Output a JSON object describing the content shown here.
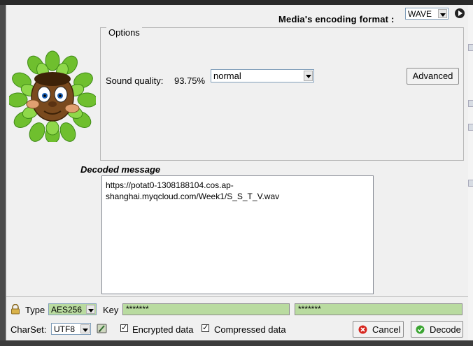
{
  "header": {
    "encoding_label": "Media's encoding format :",
    "encoding_value": "WAVE"
  },
  "options": {
    "title": "Options",
    "sound_quality_label": "Sound quality:",
    "sound_quality_value": "93.75%",
    "quality_select": "normal",
    "advanced_button": "Advanced"
  },
  "decoded": {
    "title": "Decoded message",
    "line1": "https://potat0-1308188104.cos.ap-",
    "line2": "shanghai.myqcloud.com/Week1/S_S_T_V.wav"
  },
  "footer": {
    "type_label": "Type",
    "type_value": "AES256",
    "key_label": "Key",
    "key_value": "*******",
    "key_confirm": "*******",
    "charset_label": "CharSet:",
    "charset_value": "UTF8",
    "encrypted_label": "Encrypted data",
    "compressed_label": "Compressed data",
    "cancel_button": "Cancel",
    "decode_button": "Decode"
  },
  "colors": {
    "key_field_bg": "#b9dba0",
    "window_bg": "#f0f0f0"
  }
}
